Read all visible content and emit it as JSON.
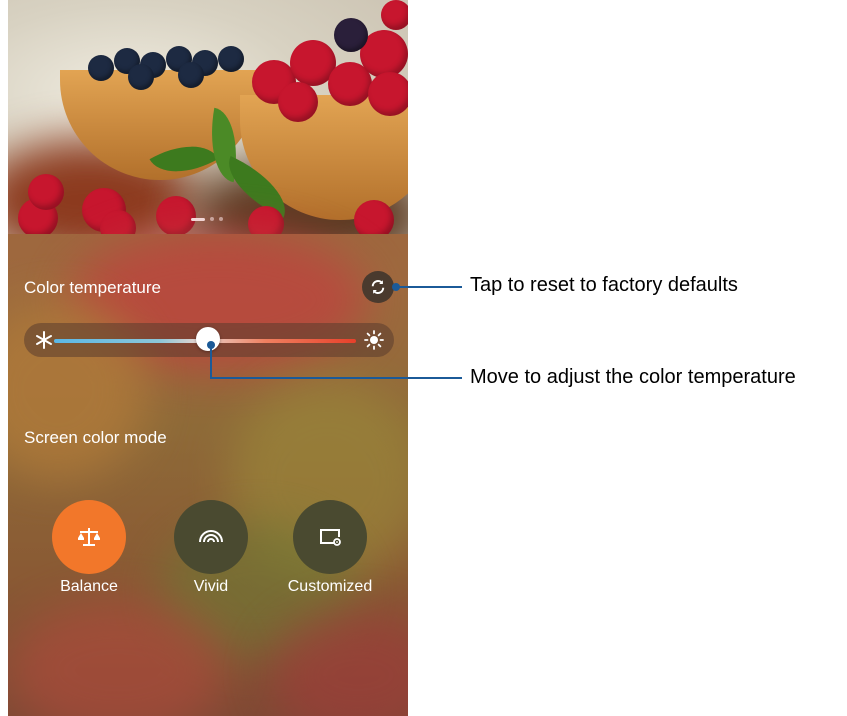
{
  "settings": {
    "color_temperature_label": "Color temperature",
    "screen_color_mode_label": "Screen color mode",
    "slider": {
      "value_fraction": 0.5
    },
    "modes": [
      {
        "label": "Balance",
        "icon": "balance-scale-icon",
        "selected": true
      },
      {
        "label": "Vivid",
        "icon": "rainbow-arcs-icon",
        "selected": false
      },
      {
        "label": "Customized",
        "icon": "screen-settings-icon",
        "selected": false
      }
    ]
  },
  "callouts": {
    "reset": "Tap to reset to factory defaults",
    "slider": "Move to adjust the color temperature"
  },
  "colors": {
    "accent": "#f2772a",
    "callout_line": "#1b5a98",
    "mode_inactive": "#4a4a30"
  },
  "icons": {
    "reset": "refresh-icon",
    "cold": "snowflake-icon",
    "warm": "sun-icon"
  }
}
